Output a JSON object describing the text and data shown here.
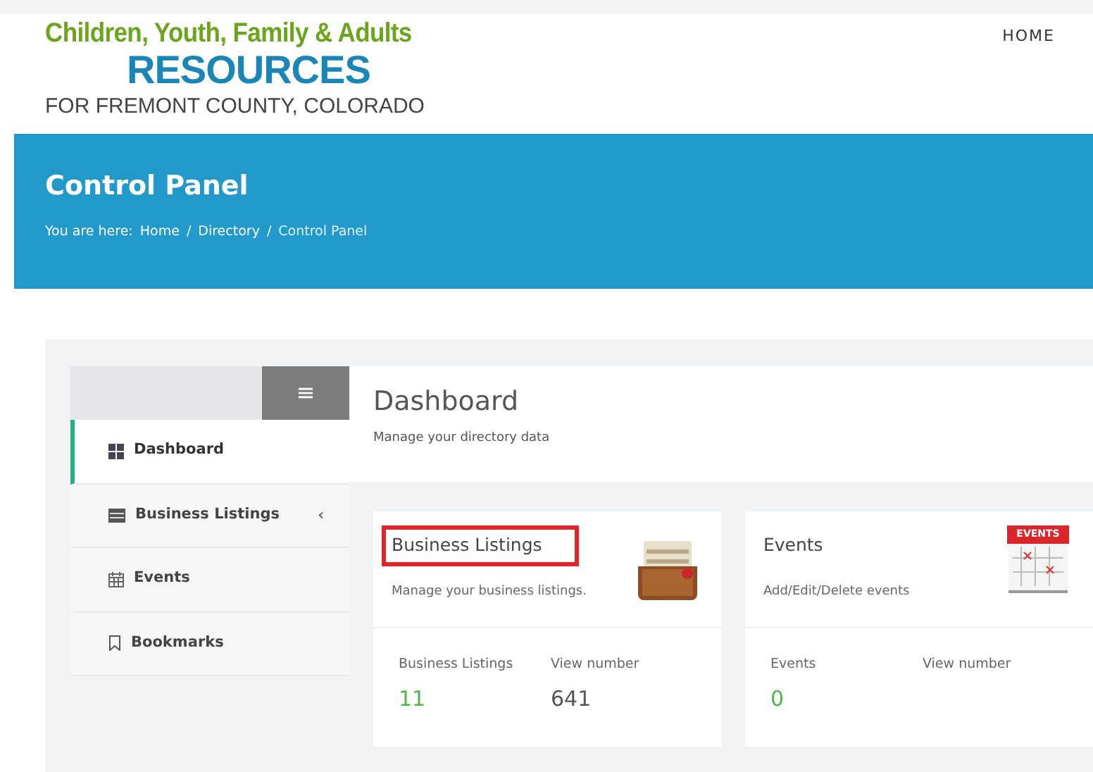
{
  "logo": {
    "line_1": "Children, Youth, Family & Adults",
    "line_2": "RESOURCES",
    "line_3": "FOR FREMONT COUNTY, COLORADO"
  },
  "nav": [
    {
      "label": "HOME"
    }
  ],
  "banner": {
    "title": "Control Panel",
    "breadcrumb_prefix": "You are here:",
    "breadcrumb": [
      {
        "label": "Home",
        "current": false
      },
      {
        "label": "Directory",
        "current": false
      },
      {
        "label": "Control Panel",
        "current": true
      }
    ],
    "separator": "/"
  },
  "sidebar": {
    "toggle": "≡",
    "items": [
      {
        "label": "Dashboard",
        "selected": true
      },
      {
        "label": "Business Listings",
        "selected": false,
        "submenu_caret": "‹"
      },
      {
        "label": "Events",
        "selected": false
      },
      {
        "label": "Bookmarks",
        "selected": false
      }
    ]
  },
  "main": {
    "title": "Dashboard",
    "subtitle": "Manage your directory data"
  },
  "cards": [
    {
      "title": "Business Listings",
      "description": "Manage your business listings.",
      "highlighted": true,
      "stats": [
        {
          "label": "Business Listings",
          "value": "11",
          "kind": "count"
        },
        {
          "label": "View number",
          "value": "641",
          "kind": "plain"
        }
      ]
    },
    {
      "title": "Events",
      "description": "Add/Edit/Delete events",
      "icon_label": "EVENTS",
      "highlighted": false,
      "stats": [
        {
          "label": "Events",
          "value": "0",
          "kind": "count"
        },
        {
          "label": "View number",
          "kind": "plain"
        }
      ]
    }
  ]
}
